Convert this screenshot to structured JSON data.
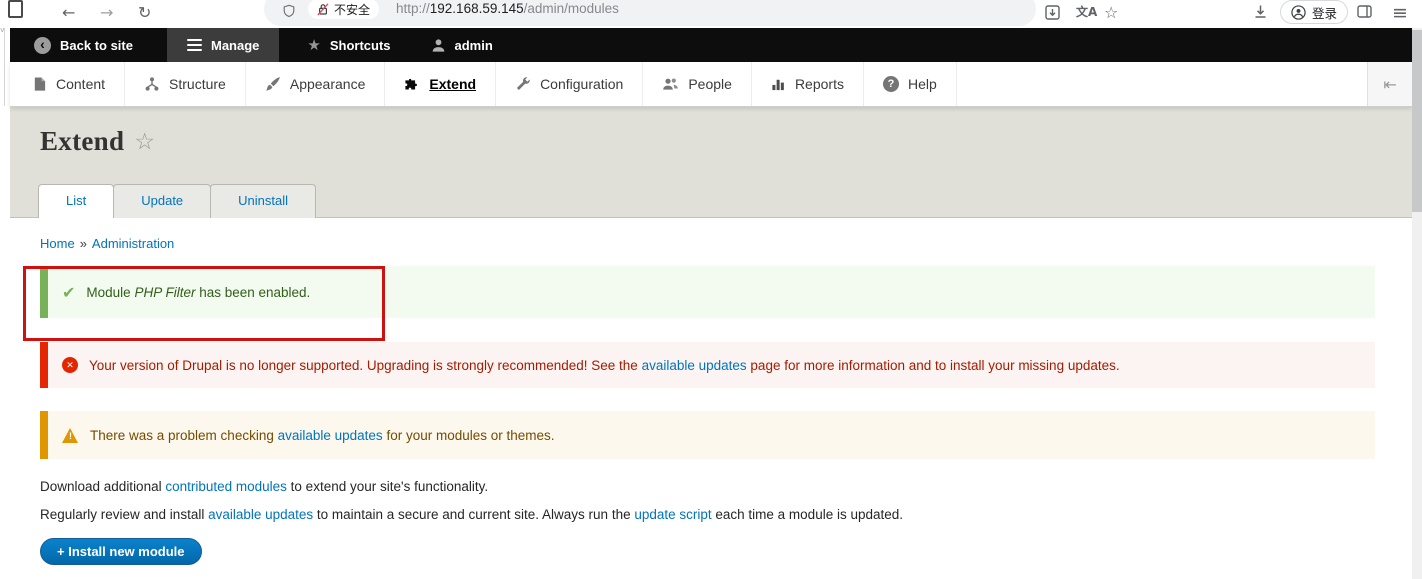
{
  "browser": {
    "back_icon": "←",
    "forward_icon": "→",
    "reload_icon": "↻",
    "security_badge": "不安全",
    "url_protocol": "http://",
    "url_host": "192.168.59.145",
    "url_path": "/admin/modules",
    "translate_icon": "文A",
    "bookmark_icon": "☆",
    "menu_icon": "≡",
    "login_label": "登录"
  },
  "admin_toolbar": {
    "back_chevron": "‹",
    "back_to_site": "Back to site",
    "manage": "Manage",
    "star_icon": "★",
    "shortcuts": "Shortcuts",
    "user": "admin"
  },
  "menu": {
    "items": [
      {
        "label": "Content"
      },
      {
        "label": "Structure"
      },
      {
        "label": "Appearance"
      },
      {
        "label": "Extend"
      },
      {
        "label": "Configuration"
      },
      {
        "label": "People"
      },
      {
        "label": "Reports"
      },
      {
        "label": "Help"
      }
    ],
    "help_icon_glyph": "?",
    "collapse_icon": "⇤"
  },
  "page": {
    "title": "Extend",
    "favorite_icon": "☆",
    "tabs": [
      {
        "label": "List"
      },
      {
        "label": "Update"
      },
      {
        "label": "Uninstall"
      }
    ],
    "breadcrumb": {
      "home": "Home",
      "separator": "»",
      "current": "Administration"
    }
  },
  "messages": {
    "success": {
      "icon": "✔",
      "prefix": "Module ",
      "module_name": "PHP Filter",
      "suffix": " has been enabled."
    },
    "error": {
      "icon": "✕",
      "before": "Your version of Drupal is no longer supported. Upgrading is strongly recommended! See the ",
      "link": "available updates",
      "after": " page for more information and to install your missing updates."
    },
    "warning": {
      "icon": "!",
      "before": "There was a problem checking ",
      "link": "available updates",
      "after": " for your modules or themes."
    }
  },
  "intro": {
    "p1": {
      "before": "Download additional ",
      "link": "contributed modules",
      "after": " to extend your site's functionality."
    },
    "p2": {
      "before": "Regularly review and install ",
      "link1": "available updates",
      "mid": " to maintain a secure and current site. Always run the ",
      "link2": "update script",
      "after": " each time a module is updated."
    }
  },
  "actions": {
    "install_button": "+ Install new module"
  },
  "colors": {
    "link": "#0074bd",
    "success_border": "#77b259",
    "success_bg": "#f3faef",
    "success_text": "#325e1c",
    "error_border": "#e62600",
    "error_bg": "#fcf4f2",
    "error_text": "#a51b00",
    "warning_border": "#e09600",
    "warning_bg": "#fdf8ed",
    "warning_text": "#734c00",
    "button_bg": "#0071b8",
    "annotation_box": "#cf1110"
  }
}
